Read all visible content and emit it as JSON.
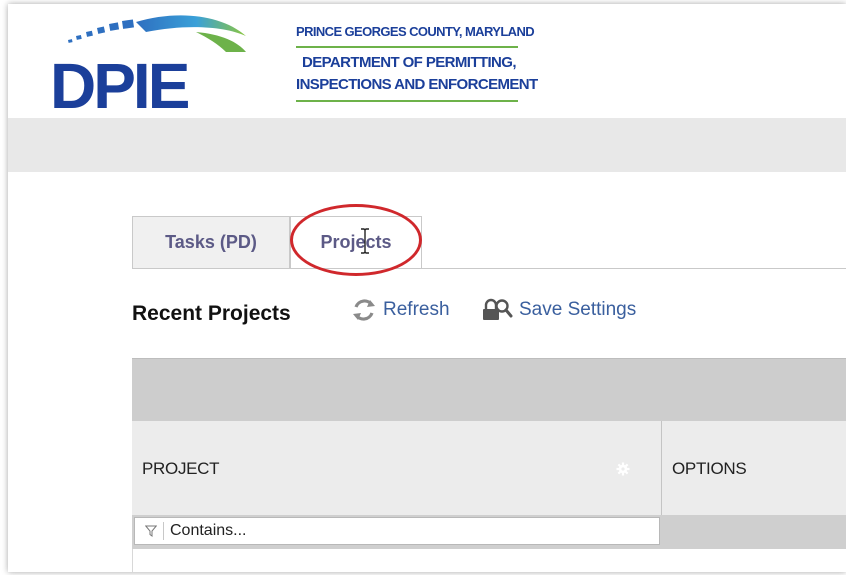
{
  "header": {
    "logo_text": "DPIE",
    "org_line1": "PRINCE GEORGES COUNTY, MARYLAND",
    "org_line2": "DEPARTMENT OF PERMITTING,",
    "org_line3": "INSPECTIONS AND ENFORCEMENT",
    "brand_blue": "#1b3f9a",
    "brand_green": "#6db24a"
  },
  "tabs": [
    {
      "label": "Tasks (PD)",
      "active": false
    },
    {
      "label": "Projects",
      "active": true
    }
  ],
  "toolbar": {
    "title": "Recent Projects",
    "refresh_label": "Refresh",
    "save_settings_label": "Save Settings"
  },
  "grid": {
    "columns": [
      {
        "label": "PROJECT"
      },
      {
        "label": "OPTIONS"
      }
    ],
    "filter_placeholder": "Contains..."
  },
  "annotation_color": "#d0282c"
}
